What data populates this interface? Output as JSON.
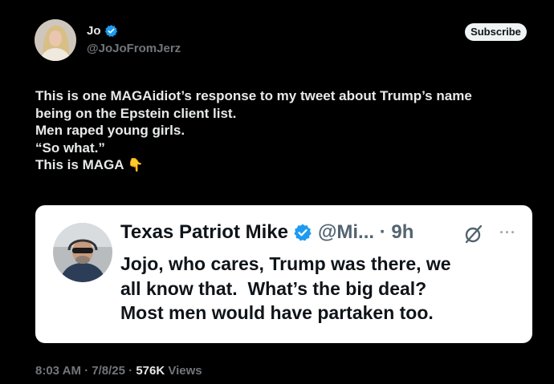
{
  "author": {
    "name": "Jo",
    "handle": "@JoJoFromJerz",
    "avatar_icon": "profile-photo"
  },
  "subscribe_label": "Subscribe",
  "tweet": {
    "lines": [
      "This is one MAGAidiot’s response to my tweet about Trump’s name",
      "being on the Epstein client list.",
      "Men raped young girls.",
      "“So what.”",
      "This is MAGA"
    ],
    "emoji": "👇"
  },
  "quote": {
    "name": "Texas Patriot Mike",
    "handle_time": "@Mi... · 9h",
    "more": "···",
    "lines": [
      "Jojo, who cares, Trump was there, we",
      "all know that.  What’s the big deal?",
      "Most men would have partaken too."
    ]
  },
  "footer": {
    "datetime": "8:03 AM · 7/8/25 · ",
    "views_count": "576K",
    "views_label": " Views"
  },
  "colors": {
    "verified": "#1d9bf0",
    "background": "#000000",
    "card": "#ffffff"
  }
}
